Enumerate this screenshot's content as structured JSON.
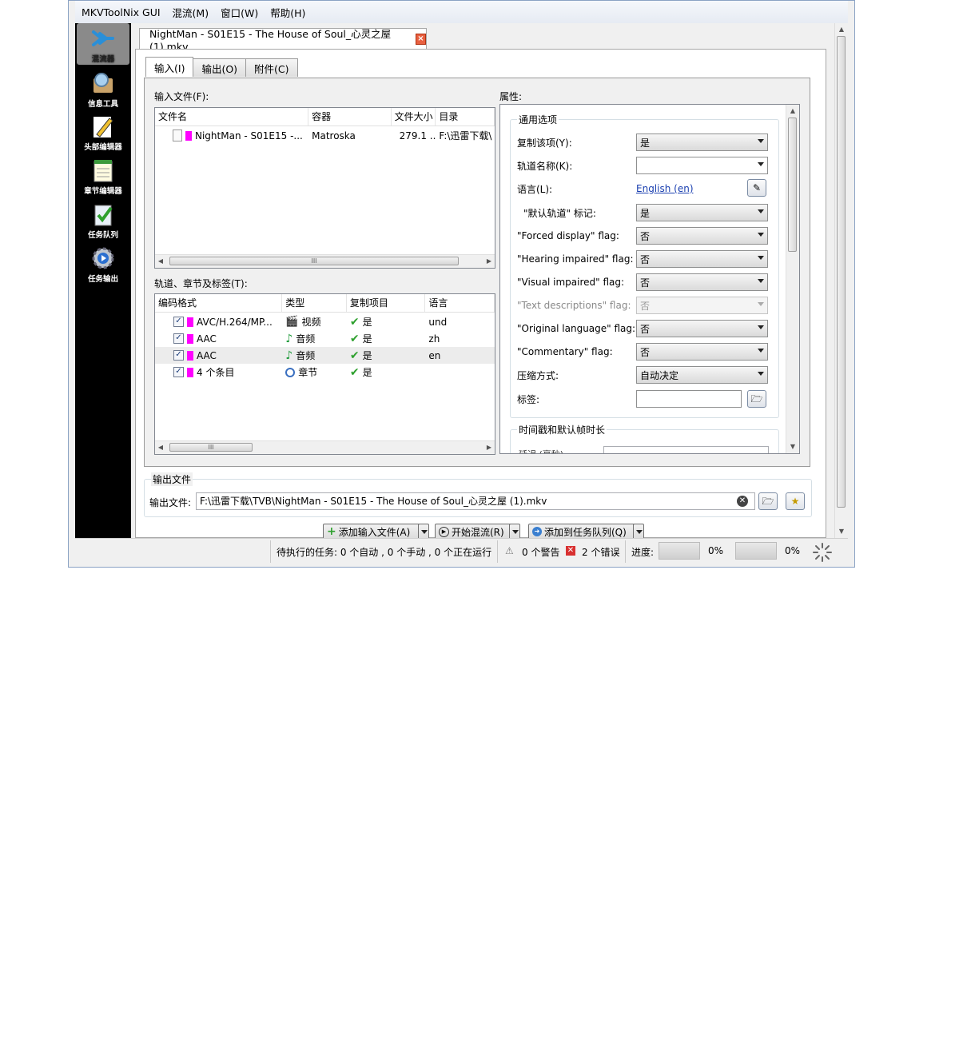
{
  "menubar": {
    "items": [
      "MKVToolNix GUI",
      "混流(M)",
      "窗口(W)",
      "帮助(H)"
    ]
  },
  "sidebar": {
    "items": [
      {
        "label": "混流器",
        "icon": "merge-arrow-icon",
        "active": true
      },
      {
        "label": "信息工具",
        "icon": "magnifier-icon",
        "active": false
      },
      {
        "label": "头部编辑器",
        "icon": "pencil-icon",
        "active": false
      },
      {
        "label": "章节编辑器",
        "icon": "notepad-icon",
        "active": false
      },
      {
        "label": "任务队列",
        "icon": "clipboard-check-icon",
        "active": false
      },
      {
        "label": "任务输出",
        "icon": "gear-play-icon",
        "active": false
      }
    ]
  },
  "document_tab": {
    "title": "NightMan - S01E15 - The House of Soul_心灵之屋 (1).mkv",
    "close": "×"
  },
  "subtabs": [
    "输入(I)",
    "输出(O)",
    "附件(C)"
  ],
  "input_files": {
    "label": "输入文件(F):",
    "columns": [
      "文件名",
      "容器",
      "文件大小",
      "目录"
    ],
    "rows": [
      {
        "name": "NightMan - S01E15 -...",
        "container": "Matroska",
        "size": "279.1 ...",
        "dir": "F:\\迅雷下载\\"
      }
    ],
    "scroll_mark": "III"
  },
  "tracks": {
    "label": "轨道、章节及标签(T):",
    "columns": [
      "编码格式",
      "类型",
      "复制项目",
      "语言"
    ],
    "rows": [
      {
        "checked": "✓",
        "codec": "AVC/H.264/MP...",
        "type": "视频",
        "type_icon": "film-icon",
        "copy": "是",
        "lang": "und"
      },
      {
        "checked": "✓",
        "codec": "AAC",
        "type": "音频",
        "type_icon": "music-note-icon",
        "copy": "是",
        "lang": "zh"
      },
      {
        "checked": "✓",
        "codec": "AAC",
        "type": "音频",
        "type_icon": "music-note-icon",
        "copy": "是",
        "lang": "en"
      },
      {
        "checked": "✓",
        "codec": "4 个条目",
        "type": "章节",
        "type_icon": "clock-icon",
        "copy": "是",
        "lang": ""
      }
    ],
    "scroll_mark": "III"
  },
  "properties": {
    "label": "属性:",
    "general_group": "通用选项",
    "rows": [
      {
        "label": "复制该项(Y):",
        "value": "是",
        "kind": "combo"
      },
      {
        "label": "轨道名称(K):",
        "value": "",
        "kind": "combo-white"
      },
      {
        "label": "语言(L):",
        "value": "English (en)",
        "kind": "link"
      },
      {
        "label": "\"默认轨道\" 标记:",
        "value": "是",
        "kind": "combo"
      },
      {
        "label": "\"Forced display\" flag:",
        "value": "否",
        "kind": "combo"
      },
      {
        "label": "\"Hearing impaired\" flag:",
        "value": "否",
        "kind": "combo"
      },
      {
        "label": "\"Visual impaired\" flag:",
        "value": "否",
        "kind": "combo"
      },
      {
        "label": "\"Text descriptions\" flag:",
        "value": "否",
        "kind": "combo-disabled"
      },
      {
        "label": "\"Original language\" flag:",
        "value": "否",
        "kind": "combo"
      },
      {
        "label": "\"Commentary\" flag:",
        "value": "否",
        "kind": "combo"
      },
      {
        "label": "压缩方式:",
        "value": "自动决定",
        "kind": "combo"
      },
      {
        "label": "标签:",
        "value": "",
        "kind": "text"
      }
    ],
    "timestamp_group": "时间戳和默认帧时长",
    "cut_row_label": "延迟 (毫秒)"
  },
  "output": {
    "group": "输出文件",
    "label": "输出文件:",
    "path": "F:\\迅雷下载\\TVB\\NightMan - S01E15 - The House of Soul_心灵之屋 (1).mkv"
  },
  "actions": {
    "add_input": "添加输入文件(A)",
    "start_mux": "开始混流(R)",
    "add_queue": "添加到任务队列(Q)"
  },
  "statusbar": {
    "jobs": "待执行的任务: 0 个自动 , 0 个手动 , 0 个正在运行",
    "warnings": "0 个警告",
    "errors": "2 个错误",
    "progress_label": "进度:",
    "progress1": "0%",
    "progress2": "0%"
  }
}
